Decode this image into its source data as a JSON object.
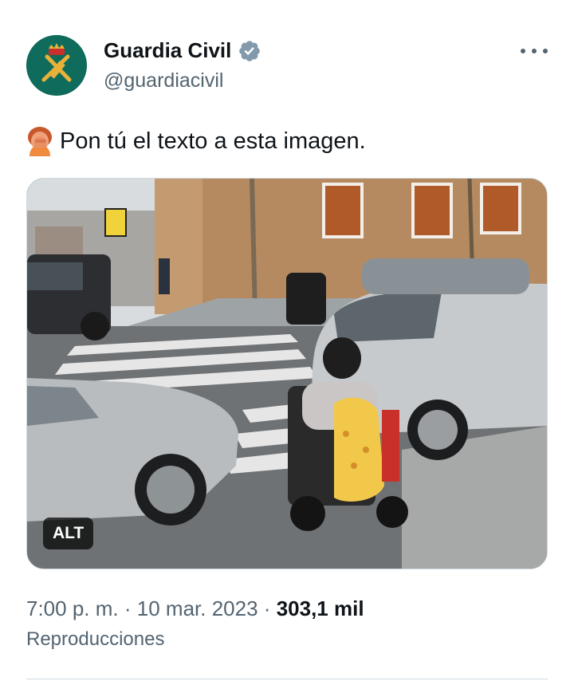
{
  "author": {
    "display_name": "Guardia Civil",
    "handle": "@guardiacivil",
    "verified": true,
    "avatar_icon": "guardia-civil-emblem-icon"
  },
  "tweet": {
    "emoji_icon": "facepalm-emoji-icon",
    "text": "Pon tú el texto a esta imagen."
  },
  "media": {
    "alt_badge": "ALT"
  },
  "meta": {
    "time": "7:00 p. m.",
    "separator": "·",
    "date": "10 mar. 2023",
    "view_count": "303,1 mil",
    "views_label": "Reproducciones"
  },
  "colors": {
    "text_primary": "#0f1419",
    "text_secondary": "#536471",
    "verified_badge": "#829aab",
    "avatar_bg": "#0f6b5b",
    "border": "#cfd9de"
  }
}
